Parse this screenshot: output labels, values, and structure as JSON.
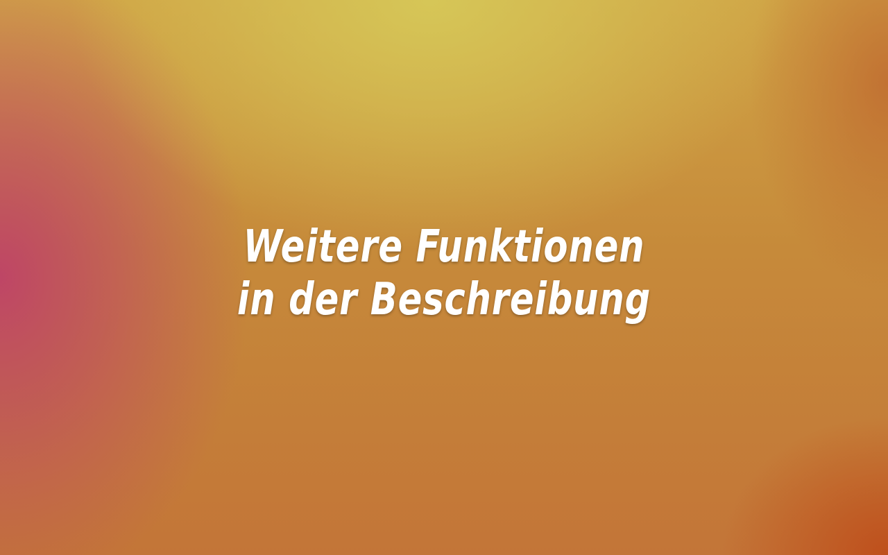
{
  "headline": {
    "line1": "Weitere Funktionen",
    "line2": "in der Beschreibung"
  },
  "colors": {
    "text": "#ffffff",
    "gradient_yellow": "#d6c858",
    "gradient_magenta": "#be4268",
    "gradient_orange": "#c58a3a",
    "gradient_dark_orange": "#be4b19"
  }
}
